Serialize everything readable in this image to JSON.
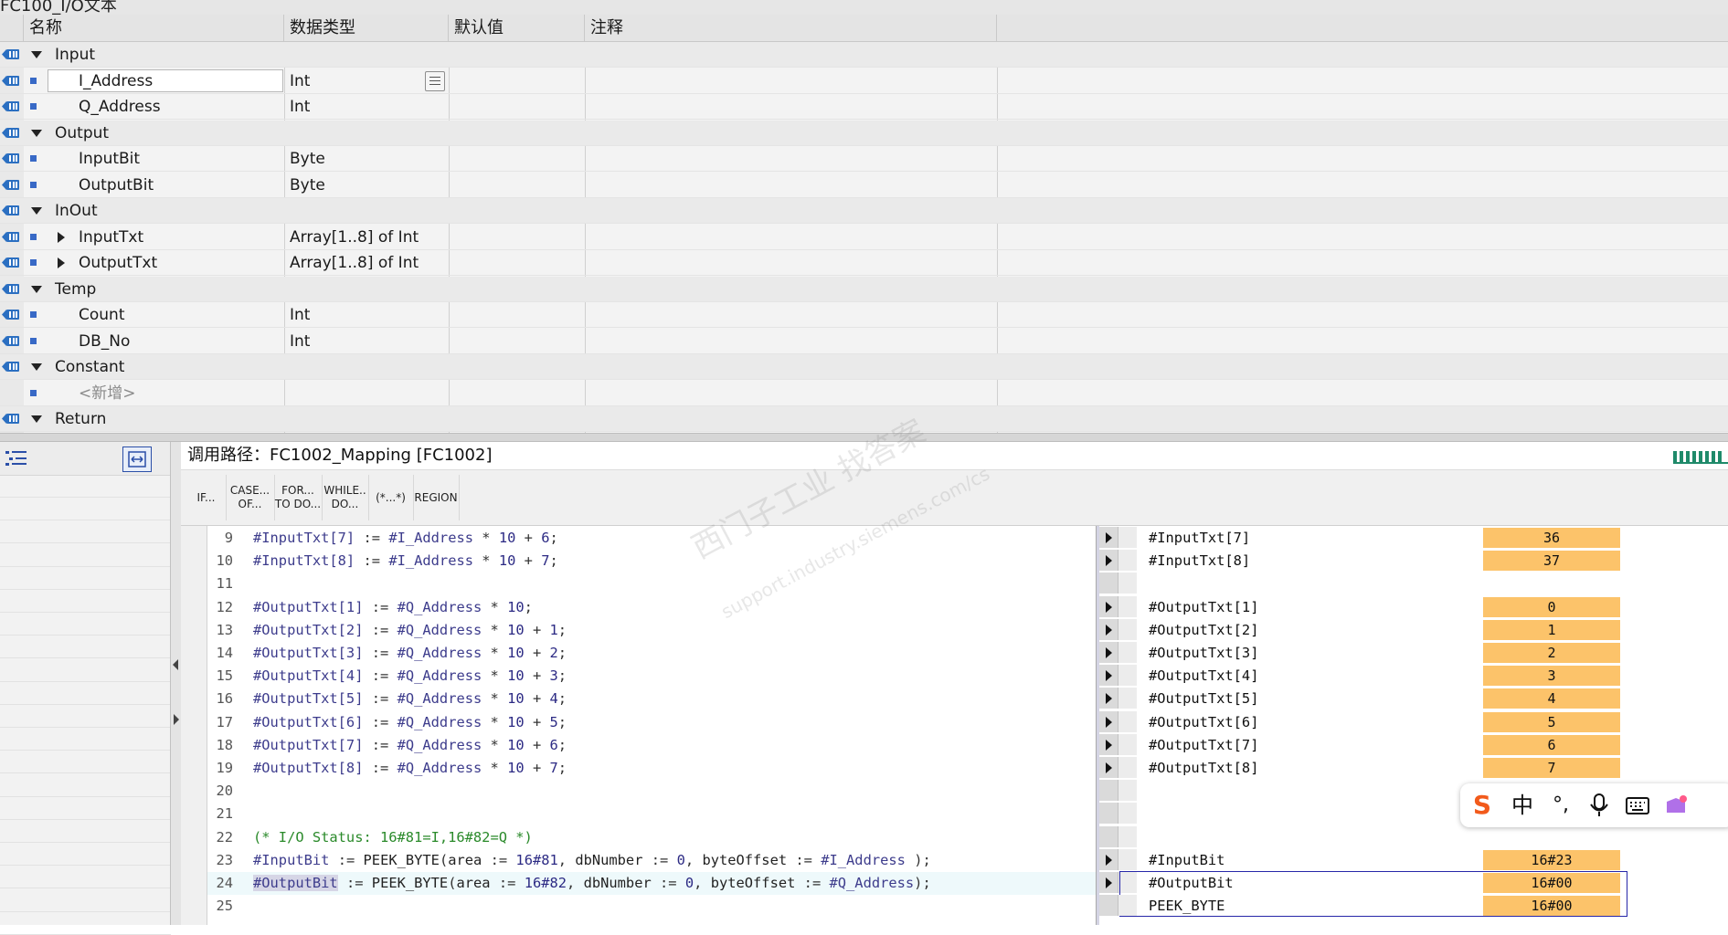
{
  "window": {
    "title": "FC100_I/O文本"
  },
  "interface": {
    "headers": {
      "name": "名称",
      "type": "数据类型",
      "default": "默认值",
      "comment": "注释"
    },
    "rows": [
      {
        "kind": "section",
        "name": "Input",
        "type": ""
      },
      {
        "kind": "var",
        "name": "I_Address",
        "type": "Int"
      },
      {
        "kind": "var",
        "name": "Q_Address",
        "type": "Int"
      },
      {
        "kind": "section",
        "name": "Output",
        "type": ""
      },
      {
        "kind": "var",
        "name": "InputBit",
        "type": "Byte"
      },
      {
        "kind": "var",
        "name": "OutputBit",
        "type": "Byte"
      },
      {
        "kind": "section",
        "name": "InOut",
        "type": ""
      },
      {
        "kind": "array",
        "name": "InputTxt",
        "type": "Array[1..8] of Int"
      },
      {
        "kind": "array",
        "name": "OutputTxt",
        "type": "Array[1..8] of Int"
      },
      {
        "kind": "section",
        "name": "Temp",
        "type": ""
      },
      {
        "kind": "var",
        "name": "Count",
        "type": "Int"
      },
      {
        "kind": "var",
        "name": "DB_No",
        "type": "Int"
      },
      {
        "kind": "section",
        "name": "Constant",
        "type": ""
      },
      {
        "kind": "new",
        "name": "<新增>",
        "type": ""
      },
      {
        "kind": "section",
        "name": "Return",
        "type": ""
      }
    ]
  },
  "editor": {
    "call_path": "调用路径：FC1002_Mapping [FC1002]",
    "toolbar": [
      {
        "label": "IF..."
      },
      {
        "label": "CASE...\nOF..."
      },
      {
        "label": "FOR...\nTO DO..."
      },
      {
        "label": "WHILE..\nDO..."
      },
      {
        "label": "(*...*)"
      },
      {
        "label": "REGION"
      }
    ],
    "lines": [
      {
        "n": "9",
        "text": "#InputTxt[7] := #I_Address * 10 + 6;"
      },
      {
        "n": "10",
        "text": "#InputTxt[8] := #I_Address * 10 + 7;"
      },
      {
        "n": "11",
        "text": ""
      },
      {
        "n": "12",
        "text": "#OutputTxt[1] := #Q_Address * 10;"
      },
      {
        "n": "13",
        "text": "#OutputTxt[2] := #Q_Address * 10 + 1;"
      },
      {
        "n": "14",
        "text": "#OutputTxt[3] := #Q_Address * 10 + 2;"
      },
      {
        "n": "15",
        "text": "#OutputTxt[4] := #Q_Address * 10 + 3;"
      },
      {
        "n": "16",
        "text": "#OutputTxt[5] := #Q_Address * 10 + 4;"
      },
      {
        "n": "17",
        "text": "#OutputTxt[6] := #Q_Address * 10 + 5;"
      },
      {
        "n": "18",
        "text": "#OutputTxt[7] := #Q_Address * 10 + 6;"
      },
      {
        "n": "19",
        "text": "#OutputTxt[8] := #Q_Address * 10 + 7;"
      },
      {
        "n": "20",
        "text": ""
      },
      {
        "n": "21",
        "text": ""
      },
      {
        "n": "22",
        "text": "(* I/O Status: 16#81=I,16#82=Q *)"
      },
      {
        "n": "23",
        "text": "#InputBit := PEEK_BYTE(area := 16#81, dbNumber := 0, byteOffset := #I_Address );"
      },
      {
        "n": "24",
        "text": "#OutputBit := PEEK_BYTE(area := 16#82, dbNumber := 0, byteOffset := #Q_Address);"
      },
      {
        "n": "25",
        "text": ""
      }
    ],
    "status": [
      {
        "name": "#InputTxt[7]",
        "value": "36"
      },
      {
        "name": "#InputTxt[8]",
        "value": "37"
      },
      null,
      {
        "name": "#OutputTxt[1]",
        "value": "0"
      },
      {
        "name": "#OutputTxt[2]",
        "value": "1"
      },
      {
        "name": "#OutputTxt[3]",
        "value": "2"
      },
      {
        "name": "#OutputTxt[4]",
        "value": "3"
      },
      {
        "name": "#OutputTxt[5]",
        "value": "4"
      },
      {
        "name": "#OutputTxt[6]",
        "value": "5"
      },
      {
        "name": "#OutputTxt[7]",
        "value": "6"
      },
      {
        "name": "#OutputTxt[8]",
        "value": "7"
      },
      null,
      null,
      null,
      {
        "name": "#InputBit",
        "value": "16#23"
      },
      {
        "name": "#OutputBit",
        "value": "16#00"
      },
      {
        "name": "PEEK_BYTE",
        "value": "16#00",
        "noarrow": true
      }
    ]
  },
  "ime_bar": {
    "icons": [
      "sogou-s-icon",
      "chinese-mode-icon",
      "punctuation-icon",
      "microphone-icon",
      "keyboard-icon",
      "skin-icon"
    ],
    "mode_label": "中"
  },
  "watermark": {
    "line1": "西门子工业 找答案",
    "line2": "support.industry.siemens.com/cs"
  },
  "colors": {
    "status_value_bg": "#fcc36a",
    "section_row_bg": "#eaeaea",
    "selection_border": "#2727a8",
    "comment_green": "#2a8a2a"
  }
}
